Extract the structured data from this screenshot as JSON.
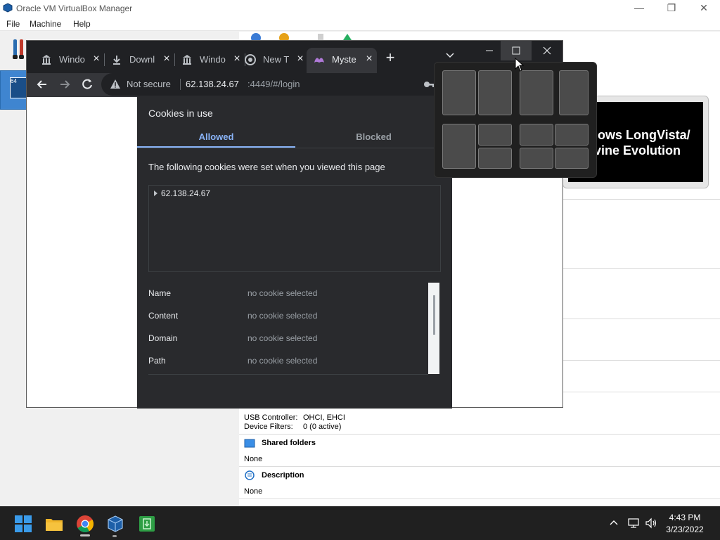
{
  "vbox": {
    "title": "Oracle VM VirtualBox Manager",
    "menu": [
      "File",
      "Machine",
      "Help"
    ],
    "vm_icon_text": "64",
    "preview_line1": "lows LongVista/",
    "preview_line2": "vine Evolution",
    "usb_controller_label": "USB Controller:",
    "usb_controller_value": "OHCI, EHCI",
    "device_filters_label": "Device Filters:",
    "device_filters_value": "0 (0 active)",
    "shared_folders_title": "Shared folders",
    "shared_folders_value": "None",
    "description_title": "Description",
    "description_value": "None"
  },
  "chrome": {
    "tabs": [
      {
        "title": "Windo",
        "icon": "museum-icon"
      },
      {
        "title": "Downl",
        "icon": "download-icon"
      },
      {
        "title": "Windo",
        "icon": "museum-icon"
      },
      {
        "title": "New T",
        "icon": "chrome-icon"
      },
      {
        "title": "Myste",
        "icon": "mystery-icon"
      }
    ],
    "new_tab": "+",
    "not_secure": "Not secure",
    "url_host": "62.138.24.67",
    "url_rest": ":4449/#/login"
  },
  "cookies_dialog": {
    "title": "Cookies in use",
    "tab_allowed": "Allowed",
    "tab_blocked": "Blocked",
    "description": "The following cookies were set when you viewed this page",
    "tree_host": "62.138.24.67",
    "details": [
      {
        "key": "Name",
        "value": "no cookie selected"
      },
      {
        "key": "Content",
        "value": "no cookie selected"
      },
      {
        "key": "Domain",
        "value": "no cookie selected"
      },
      {
        "key": "Path",
        "value": "no cookie selected"
      }
    ]
  },
  "taskbar": {
    "time": "4:43 PM",
    "date": "3/23/2022"
  },
  "colors": {
    "chrome_dark": "#202124",
    "chrome_toolbar": "#35363a",
    "dialog_bg": "#292a2d",
    "accent_blue": "#8ab4f8",
    "vbox_selection": "#3f85d0"
  }
}
